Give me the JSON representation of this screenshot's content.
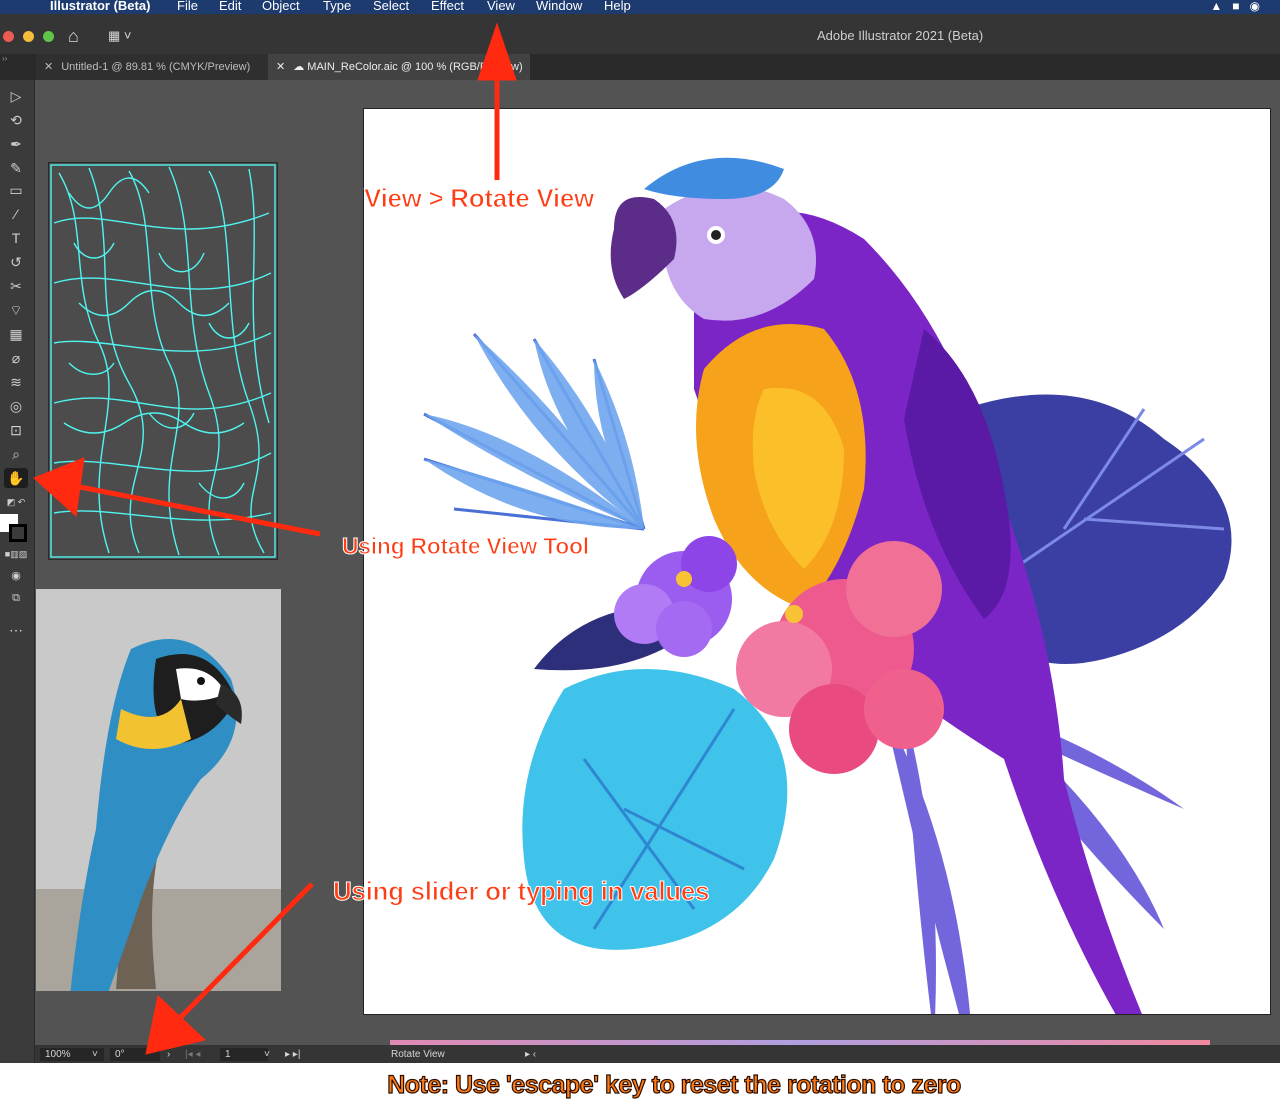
{
  "menubar": {
    "app": "Illustrator (Beta)",
    "items": [
      "File",
      "Edit",
      "Object",
      "Type",
      "Select",
      "Effect",
      "View",
      "Window",
      "Help"
    ]
  },
  "window": {
    "title": "Adobe Illustrator 2021 (Beta)"
  },
  "tabs": [
    {
      "label": "Untitled-1 @ 89.81 % (CMYK/Preview)"
    },
    {
      "label": "MAIN_ReColor.aic @ 100 % (RGB/Preview)"
    }
  ],
  "status": {
    "zoom": "100%",
    "rotation": "0°",
    "artboard": "1",
    "tool": "Rotate View"
  },
  "annotations": {
    "view_menu": "View > Rotate View",
    "tool": "Using Rotate View Tool",
    "slider": "Using slider or typing in values",
    "note": "Note: Use 'escape' key to reset the rotation to zero"
  },
  "colors": {
    "annotation_red": "#ff3d14",
    "note_orange": "#fd7b17",
    "cyan_art": "#4ff5f0"
  }
}
